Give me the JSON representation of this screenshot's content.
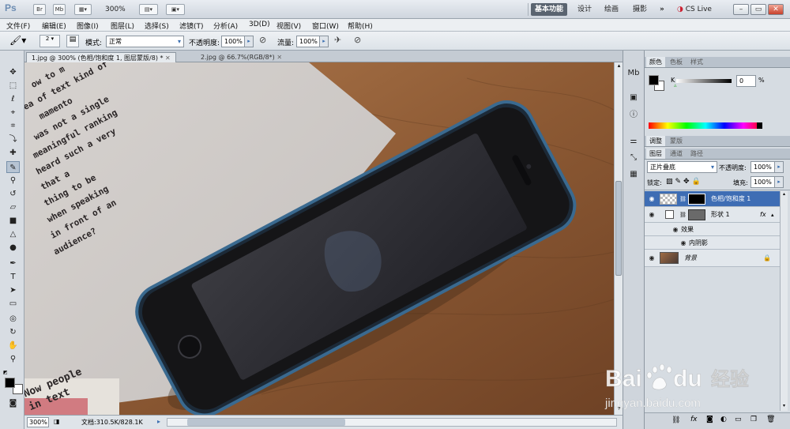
{
  "app": {
    "logo": "Ps",
    "bridge_btn": "Br",
    "minibridge_btn": "Mb",
    "zoom_level": "300%",
    "workspaces": [
      "基本功能",
      "设计",
      "绘画",
      "摄影"
    ],
    "more_btn": "»",
    "cslive": "CS Live"
  },
  "menu": [
    "文件(F)",
    "编辑(E)",
    "图像(I)",
    "图层(L)",
    "选择(S)",
    "滤镜(T)",
    "分析(A)",
    "3D(D)",
    "视图(V)",
    "窗口(W)",
    "帮助(H)"
  ],
  "options": {
    "brush_size": "2",
    "mode_label": "模式:",
    "mode_value": "正常",
    "opacity_label": "不透明度:",
    "opacity_value": "100%",
    "flow_label": "流量:",
    "flow_value": "100%"
  },
  "tabs": [
    {
      "label": "1.jpg @ 300% (色相/饱和度 1, 图层蒙版/8) *",
      "active": true
    },
    {
      "label": "2.jpg @ 66.7%(RGB/8*)",
      "active": false
    }
  ],
  "status": {
    "zoom": "300%",
    "doc": "文档:310.5K/828.1K"
  },
  "canvas_text": {
    "lines": [
      "ow to m",
      "ea of text kind of",
      "mamento",
      "was not a single",
      "meaningful ranking",
      "heard such a very",
      "that a",
      "thing to be",
      "when speaking",
      "in front of an",
      "audience?"
    ],
    "bottom": [
      "Now people",
      "in text"
    ]
  },
  "color_panel": {
    "tabs": [
      "颜色",
      "色板",
      "样式"
    ],
    "channel": "K",
    "value": "0",
    "unit": "%"
  },
  "adjust_panel": {
    "tabs": [
      "调整",
      "蒙版"
    ]
  },
  "layers_panel": {
    "tabs": [
      "图层",
      "通道",
      "路径"
    ],
    "blend_mode": "正片叠底",
    "opacity_label": "不透明度:",
    "opacity_value": "100%",
    "lock_label": "锁定:",
    "fill_label": "填充:",
    "fill_value": "100%",
    "layers": [
      {
        "name": "色相/饱和度 1",
        "selected": true
      },
      {
        "name": "形状 1",
        "selected": false,
        "fx": "fx"
      },
      {
        "name": "效果",
        "selected": false
      },
      {
        "name": "内阴影",
        "selected": false
      },
      {
        "name": "背景",
        "selected": false
      }
    ]
  },
  "watermark": {
    "brand": "Bai",
    "brand2": "du",
    "cn": "经验",
    "url": "jingyan.baidu.com"
  }
}
